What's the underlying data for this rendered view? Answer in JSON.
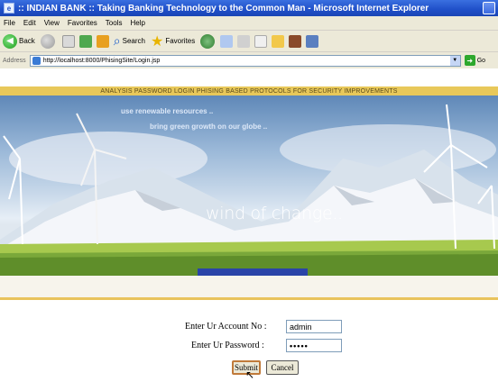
{
  "window": {
    "title": ":: INDIAN BANK :: Taking Banking Technology to the Common Man - Microsoft Internet Explorer"
  },
  "menu": {
    "items": [
      "File",
      "Edit",
      "View",
      "Favorites",
      "Tools",
      "Help"
    ]
  },
  "toolbar": {
    "back_label": "Back",
    "search_label": "Search",
    "favorites_label": "Favorites"
  },
  "address": {
    "label": "Address",
    "url": "http://localhost:8000/PhisingSite/Login.jsp",
    "go_label": "Go"
  },
  "banner": {
    "strip_text": "ANALYSIS PASSWORD LOGIN PHISING BASED PROTOCOLS FOR SECURITY IMPROVEMENTS"
  },
  "hero": {
    "line1": "use renewable resources ..",
    "line2": "bring green growth on our globe ..",
    "caption": "wind of change.."
  },
  "form": {
    "account_label": "Enter Ur Account No :",
    "account_value": "admin",
    "password_label": "Enter Ur Password :",
    "password_value": "•••••",
    "submit_label": "Submit",
    "cancel_label": "Cancel"
  }
}
